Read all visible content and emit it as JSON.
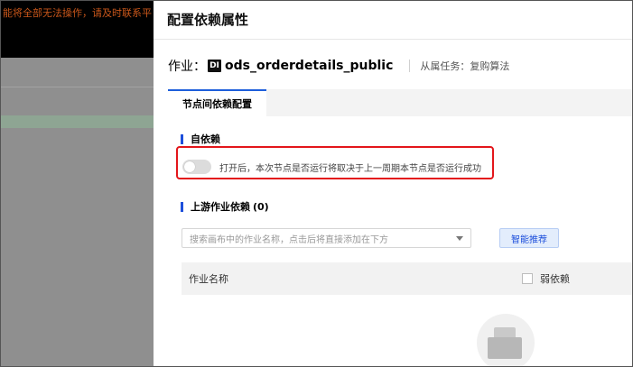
{
  "background": {
    "banner_text": "能将全部无法操作，请及时联系平"
  },
  "drawer": {
    "title": "配置依赖属性",
    "job_label": "作业：",
    "job_icon_text": "DI",
    "job_name": "ods_orderdetails_public",
    "parent_label": "从属任务：",
    "parent_value": "复购算法",
    "tabs": [
      {
        "label": "节点间依赖配置",
        "active": true
      }
    ],
    "self_dependency": {
      "title": "自依赖",
      "toggle_on": false,
      "description": "打开后，本次节点是否运行将取决于上一周期本节点是否运行成功"
    },
    "upstream": {
      "title": "上游作业依赖",
      "count": "(0)",
      "search_placeholder": "搜索画布中的作业名称，点击后将直接添加在下方",
      "recommend_button": "智能推荐",
      "table": {
        "col_name": "作业名称",
        "col_weak": "弱依赖"
      }
    }
  },
  "colors": {
    "accent": "#1d4fdb",
    "highlight": "#e3161b",
    "banner_text": "#c8561a"
  }
}
